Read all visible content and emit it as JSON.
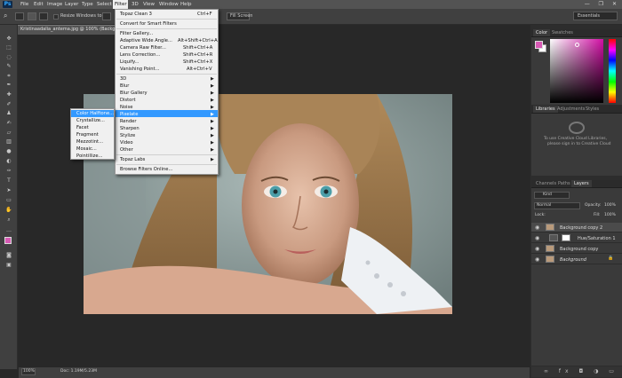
{
  "app": {
    "logo": "Ps",
    "menus": [
      "File",
      "Edit",
      "Image",
      "Layer",
      "Type",
      "Select",
      "Filter",
      "3D",
      "View",
      "Window",
      "Help"
    ],
    "window_controls": "— ❐ ✕"
  },
  "options_bar": {
    "resize_windows_label": "Resize Windows to Fit",
    "fill_screen_label": "Fill Screen",
    "workspace": "Essentials"
  },
  "document": {
    "tab_title": "Kristinaadalia_antema.jpg @ 100% (Background c...",
    "zoom": "100%",
    "doc_info": "Doc: 1.19M/5.23M"
  },
  "filter_menu": {
    "last_filter": "Topaz Clean 3",
    "last_filter_shortcut": "Ctrl+F",
    "convert_smart": "Convert for Smart Filters",
    "items_main": [
      {
        "label": "Filter Gallery...",
        "shortcut": ""
      },
      {
        "label": "Adaptive Wide Angle...",
        "shortcut": "Alt+Shift+Ctrl+A"
      },
      {
        "label": "Camera Raw Filter...",
        "shortcut": "Shift+Ctrl+A"
      },
      {
        "label": "Lens Correction...",
        "shortcut": "Shift+Ctrl+R"
      },
      {
        "label": "Liquify...",
        "shortcut": "Shift+Ctrl+X"
      },
      {
        "label": "Vanishing Point...",
        "shortcut": "Alt+Ctrl+V"
      }
    ],
    "submenus": [
      "3D",
      "Blur",
      "Blur Gallery",
      "Distort",
      "Noise",
      "Pixelate",
      "Render",
      "Sharpen",
      "Stylize",
      "Video",
      "Other"
    ],
    "topaz": "Topaz Labs",
    "browse": "Browse Filters Online..."
  },
  "pixelate_submenu": {
    "items": [
      "Color Halftone...",
      "Crystallize...",
      "Facet",
      "Fragment",
      "Mezzotint...",
      "Mosaic...",
      "Pointillize..."
    ]
  },
  "panels": {
    "color_tabs": [
      "Color",
      "Swatches"
    ],
    "library_tabs": [
      "Libraries",
      "Adjustments",
      "Styles"
    ],
    "library_message_1": "To use Creative Cloud Libraries,",
    "library_message_2": "please sign in to Creative Cloud",
    "layer_tabs": [
      "Channels",
      "Paths",
      "Layers"
    ],
    "kind_filter": "Kind",
    "blend_mode": "Normal",
    "opacity_label": "Opacity:",
    "opacity_value": "100%",
    "lock_label": "Lock:",
    "fill_label": "Fill:",
    "fill_value": "100%",
    "layers": [
      {
        "name": "Background copy 2",
        "selected": true
      },
      {
        "name": "Hue/Saturation 1",
        "selected": false
      },
      {
        "name": "Background copy",
        "selected": false
      },
      {
        "name": "Background",
        "selected": false
      }
    ],
    "colors": {
      "foreground": "#d75ab4",
      "background": "#ffffff",
      "highlight": "#3399ff"
    }
  }
}
